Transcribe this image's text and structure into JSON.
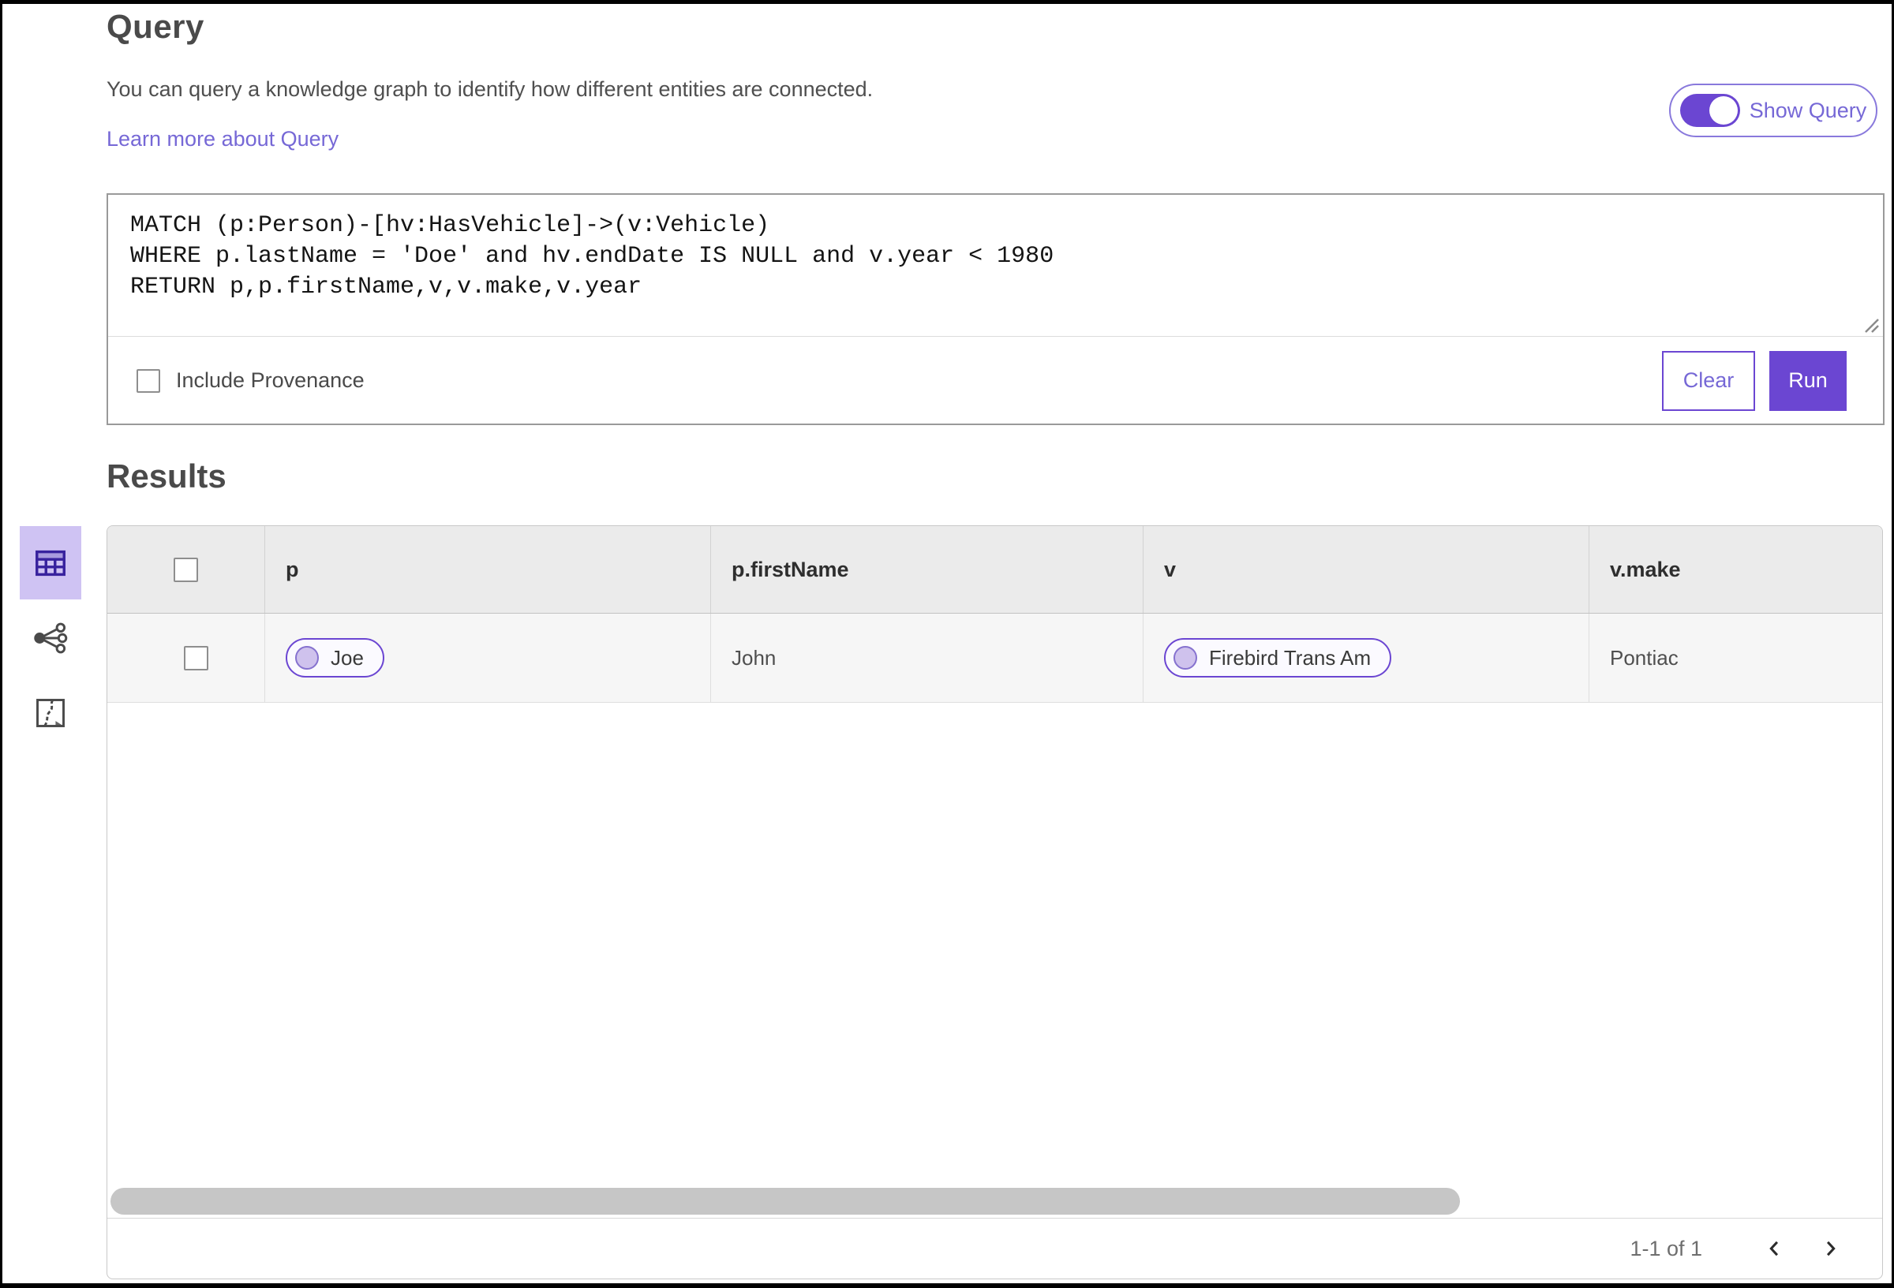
{
  "header": {
    "title": "Query",
    "description": "You can query a knowledge graph to identify how different entities are connected.",
    "learn_more": "Learn more about Query",
    "show_query": {
      "label": "Show Query",
      "enabled": true
    }
  },
  "query_panel": {
    "lines": [
      "MATCH (p:Person)-[hv:HasVehicle]->(v:Vehicle)",
      "WHERE p.lastName = 'Doe' and hv.endDate IS NULL and v.year < 1980",
      "RETURN p,p.firstName,v,v.make,v.year"
    ],
    "include_provenance": {
      "label": "Include Provenance",
      "checked": false
    },
    "clear_label": "Clear",
    "run_label": "Run"
  },
  "results": {
    "title": "Results",
    "view_switcher": [
      {
        "id": "table-view",
        "icon": "table-icon",
        "selected": true
      },
      {
        "id": "link-chart-view",
        "icon": "link-chart-icon",
        "selected": false
      },
      {
        "id": "map-view",
        "icon": "map-icon",
        "selected": false
      }
    ],
    "table": {
      "columns": [
        {
          "label": "p"
        },
        {
          "label": "p.firstName"
        },
        {
          "label": "v"
        },
        {
          "label": "v.make"
        }
      ],
      "rows": [
        {
          "selected": false,
          "cells": [
            {
              "type": "entity-chip",
              "label": "Joe"
            },
            {
              "type": "text",
              "label": "John"
            },
            {
              "type": "entity-chip",
              "label": "Firebird Trans Am"
            },
            {
              "type": "text",
              "label": "Pontiac"
            }
          ]
        }
      ],
      "pagination": {
        "range_label": "1-1 of 1"
      }
    }
  },
  "colors": {
    "primary_purple": "#6b46d2",
    "link_purple": "#7668d6",
    "selected_tile_bg": "#cfc3f3",
    "selected_tile_icon": "#38229e",
    "chip_bg": "#fbfaff",
    "chip_circle_fill": "#cfc2ed",
    "chip_circle_border": "#8672cf",
    "table_header_bg": "#ebebeb",
    "table_row_bg": "#f6f6f6"
  }
}
